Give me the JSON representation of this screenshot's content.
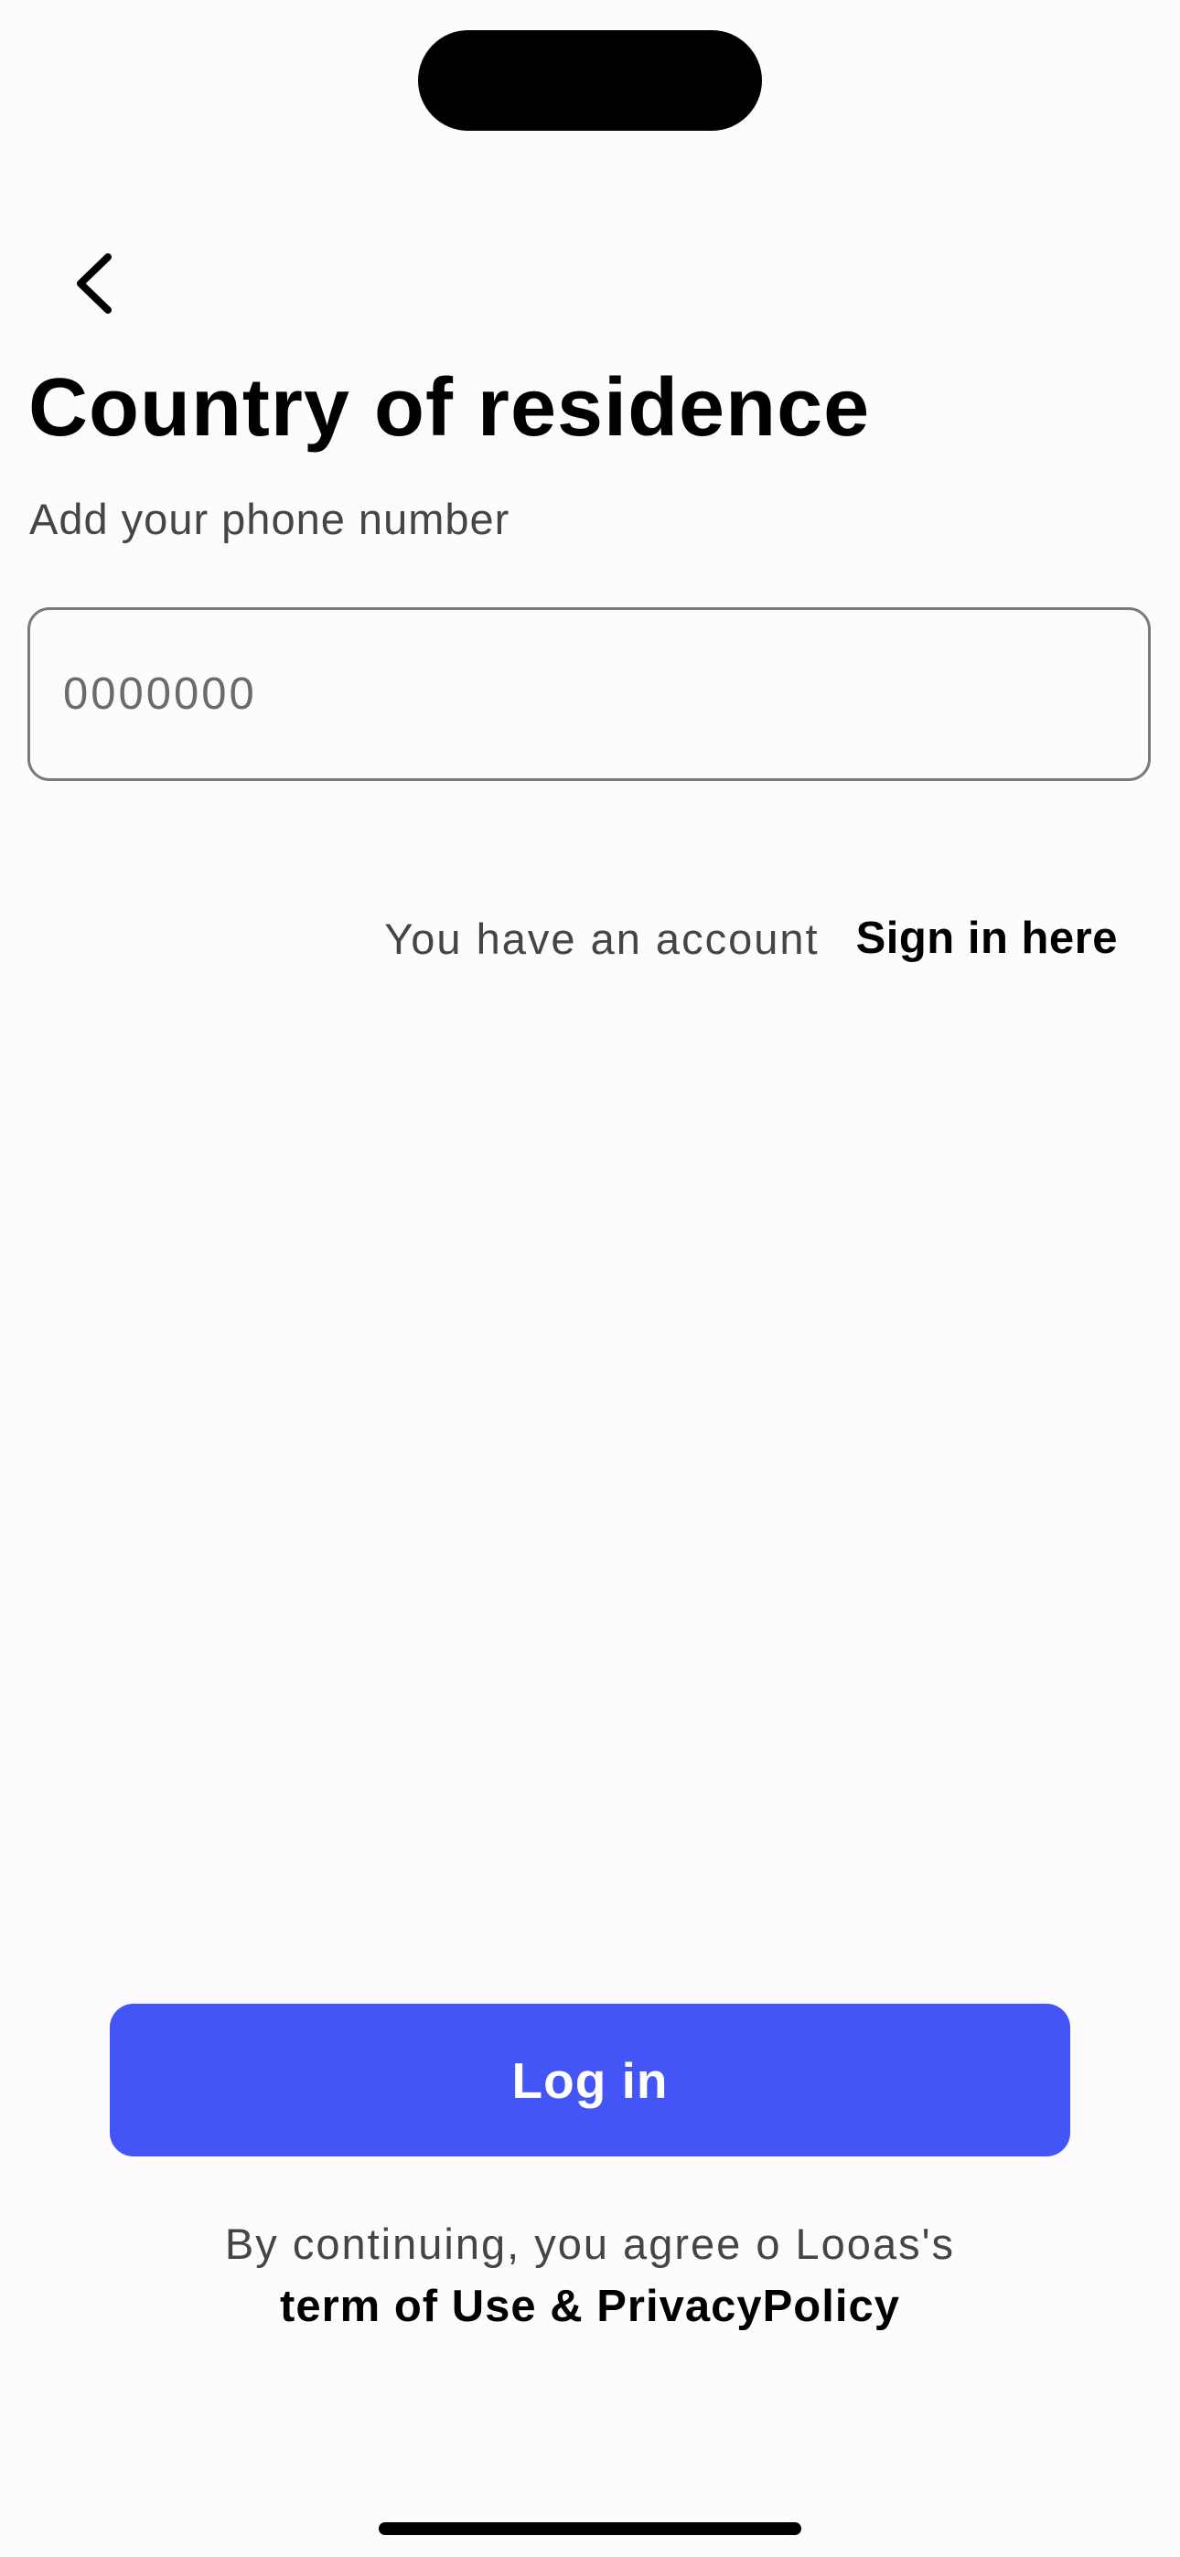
{
  "screen": {
    "title": "Country of residence",
    "subtitle": "Add your phone number"
  },
  "phone_input": {
    "value": "",
    "placeholder": "0000000"
  },
  "account_prompt": {
    "text": "You have an account",
    "link_label": "Sign in here"
  },
  "actions": {
    "login_label": "Log in"
  },
  "consent": {
    "text": "By continuing, you agree o Looas's",
    "link_label": "term of Use & PrivacyPolicy"
  },
  "icons": {
    "back": "chevron-left-icon"
  },
  "colors": {
    "background": "#fefbfe",
    "primary": "#4355f7",
    "text_primary": "#000000",
    "text_secondary": "#454545",
    "input_border": "#7a7a7a"
  }
}
